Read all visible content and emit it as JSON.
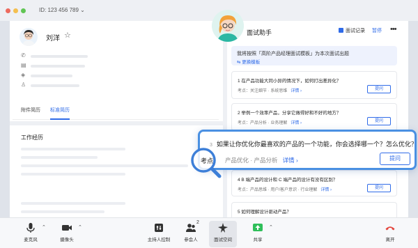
{
  "window": {
    "meeting_id": "ID: 123 456 789 ⌄"
  },
  "candidate": {
    "name": "刘洋",
    "tabs": [
      "附件简历",
      "标准简历"
    ],
    "active_tab_index": 1
  },
  "resume": {
    "section_title": "工作经历"
  },
  "assistant": {
    "title": "面试助手",
    "record_label": "面试记录",
    "pause_label": "暂停",
    "intro_text": "我将按照「高阶产品经理面试模板」为本次面试出题",
    "change_template_label": "更换模板",
    "questions": [
      {
        "text": "1   在产品功能大同小异的情况下，如何打出差异化？",
        "meta": "考点：关注细节 · 系统思维",
        "detail": "详情 ›",
        "ask": "提问"
      },
      {
        "text": "2   举例一个效率产品，分享它做得好和不好的地方？",
        "meta": "考点：产品分析 · 业务理解",
        "detail": "详情 ›",
        "ask": "提问"
      },
      {
        "text": "4   B 端产品的设计和 C 端产品的设计有没有区别？",
        "meta": "考点：产品思维 · 用户/客户意识 · 行业理解",
        "detail": "详情 ›",
        "ask": "提问"
      },
      {
        "text": "5   如何理解设计驱动产品？",
        "meta": "",
        "detail": "",
        "ask": ""
      }
    ],
    "highlighted": {
      "number": "3",
      "text": "如果让你优化你最喜欢的产品的一个功能，你会选择哪一个？怎么优化？",
      "meta_label": "考点",
      "meta": "产品优化 · 产品分析",
      "detail": "详情 ›",
      "ask": "提问"
    }
  },
  "toolbar": {
    "items": [
      {
        "label": "麦克风",
        "icon": "microphone-icon"
      },
      {
        "label": "摄像头",
        "icon": "camera-icon"
      },
      {
        "label": "主持人控制",
        "icon": "host-control-icon"
      },
      {
        "label": "参会人",
        "icon": "participants-icon",
        "badge": "2"
      },
      {
        "label": "面试空间",
        "icon": "interview-space-icon"
      },
      {
        "label": "共享",
        "icon": "share-icon"
      },
      {
        "label": "离开",
        "icon": "leave-icon"
      }
    ]
  },
  "colors": {
    "accent": "#2f6be8",
    "callout_border": "#4a90e2",
    "share_green": "#2fbf5a",
    "leave_red": "#e3443b"
  }
}
